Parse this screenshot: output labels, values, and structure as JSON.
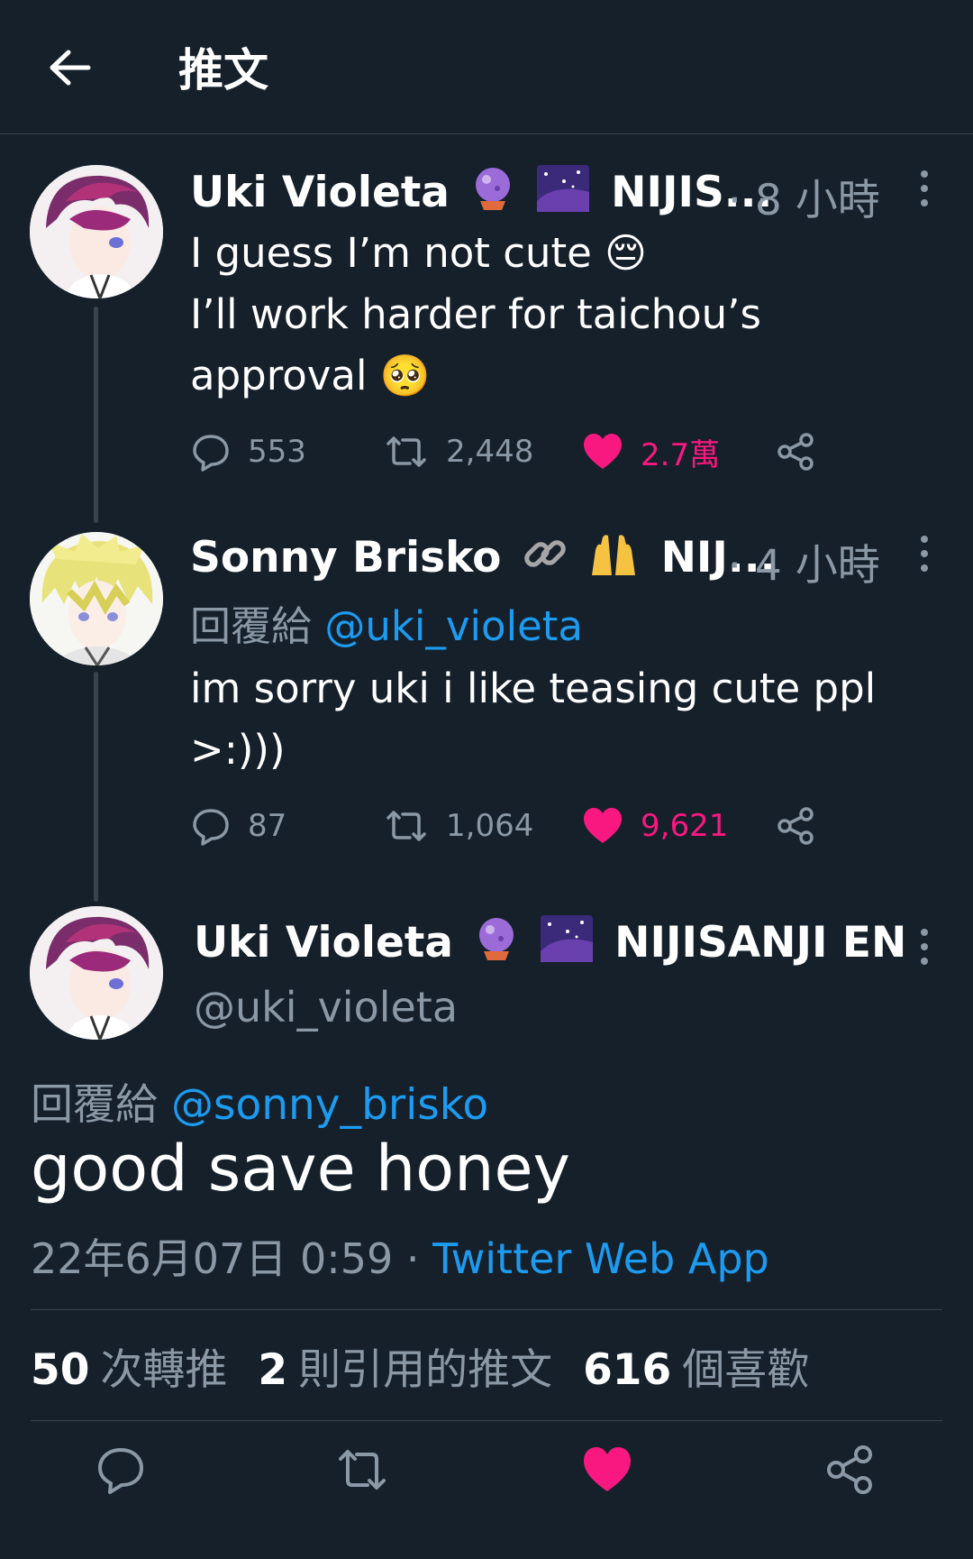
{
  "header": {
    "title": "推文",
    "back_icon": "arrow-left-icon"
  },
  "colors": {
    "background": "#15202b",
    "accent": "#1d9bf0",
    "like": "#f91880",
    "muted": "#8b98a5",
    "divider": "#38444d"
  },
  "tweets": [
    {
      "name": "Uki Violeta",
      "emojis": [
        "crystal-ball-icon",
        "milky-way-icon"
      ],
      "affiliation": "NIJIS...",
      "time": "· 8 小時",
      "lines": [
        "I guess I’m not cute 😔",
        "I’ll work harder for taichou’s",
        "approval 🥺"
      ],
      "replies": "553",
      "retweets": "2,448",
      "likes": "2.7萬"
    },
    {
      "name": "Sonny Brisko",
      "emojis": [
        "link-icon",
        "raising-hands-icon"
      ],
      "affiliation": "NIJ...",
      "time": "· 4 小時",
      "reply_prefix": "回覆給",
      "reply_handle": "@uki_violeta",
      "lines": [
        "im sorry uki i like teasing cute ppl",
        ">:)))"
      ],
      "replies": "87",
      "retweets": "1,064",
      "likes": "9,621"
    }
  ],
  "main": {
    "name": "Uki Violeta",
    "emojis": [
      "crystal-ball-icon",
      "milky-way-icon"
    ],
    "affiliation": "NIJISANJI EN",
    "handle": "@uki_violeta",
    "reply_prefix": "回覆給",
    "reply_handle": "@sonny_brisko",
    "text": "good save honey",
    "timestamp": "22年6月07日 0:59",
    "separator": "·",
    "source": "Twitter Web App",
    "stats": [
      {
        "num": "50",
        "label": "次轉推"
      },
      {
        "num": "2",
        "label": "則引用的推文"
      },
      {
        "num": "616",
        "label": "個喜歡"
      }
    ]
  },
  "bottom_actions": [
    "reply-icon",
    "retweet-icon",
    "like-icon",
    "share-icon"
  ]
}
